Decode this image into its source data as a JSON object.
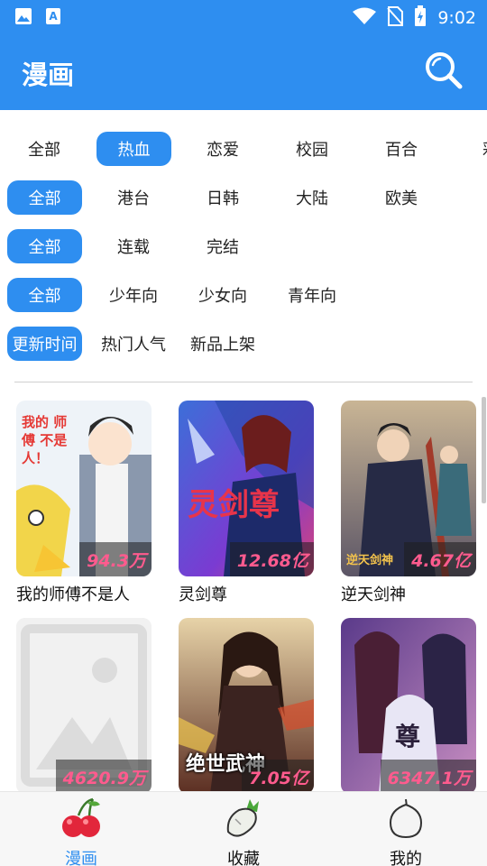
{
  "status_bar": {
    "time": "9:02"
  },
  "app_bar": {
    "title": "漫画"
  },
  "filters": {
    "genres": [
      "全部",
      "热血",
      "恋爱",
      "校园",
      "百合",
      "彩"
    ],
    "genre_active": 1,
    "regions": [
      "全部",
      "港台",
      "日韩",
      "大陆",
      "欧美"
    ],
    "status": [
      "全部",
      "连载",
      "完结"
    ],
    "audience": [
      "全部",
      "少年向",
      "少女向",
      "青年向"
    ],
    "sort": [
      "更新时间",
      "热门人气",
      "新品上架"
    ]
  },
  "comics": [
    {
      "title": "我的师傅不是人",
      "views": "94.3万",
      "cover_text": "我的 师傅 不是人！"
    },
    {
      "title": "灵剑尊",
      "views": "12.68亿",
      "cover_text": "灵剑尊"
    },
    {
      "title": "逆天剑神",
      "views": "4.67亿",
      "cover_text": "逆天剑神"
    },
    {
      "title": "",
      "views": "4620.9万",
      "cover_text": ""
    },
    {
      "title": "",
      "views": "7.05亿",
      "cover_text": "绝世武神"
    },
    {
      "title": "",
      "views": "6347.1万",
      "cover_text": "尊"
    }
  ],
  "bottom_nav": [
    {
      "label": "漫画",
      "icon": "cherries-icon"
    },
    {
      "label": "收藏",
      "icon": "radish-icon"
    },
    {
      "label": "我的",
      "icon": "onion-icon"
    }
  ],
  "colors": {
    "primary": "#2e8ef0",
    "view_count": "#ff5b8e"
  }
}
